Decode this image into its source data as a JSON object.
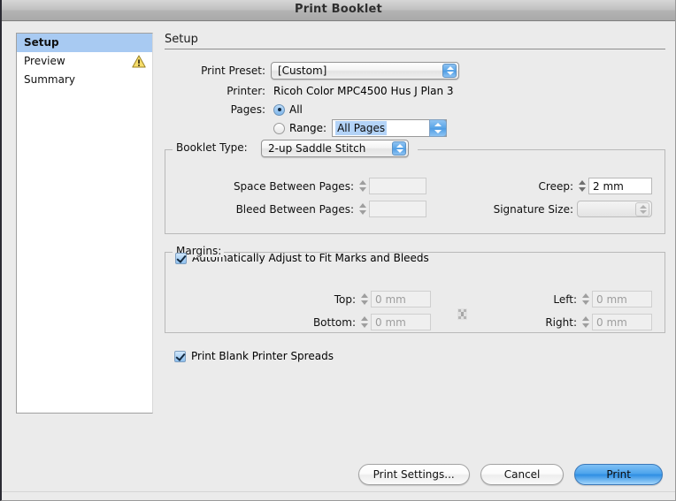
{
  "window": {
    "title": "Print Booklet"
  },
  "sidebar": {
    "items": [
      {
        "label": "Setup",
        "selected": true,
        "warning": false
      },
      {
        "label": "Preview",
        "selected": false,
        "warning": true
      },
      {
        "label": "Summary",
        "selected": false,
        "warning": false
      }
    ]
  },
  "panel": {
    "title": "Setup",
    "print_preset": {
      "label": "Print Preset:",
      "value": "[Custom]"
    },
    "printer": {
      "label": "Printer:",
      "value": "Ricoh Color MPC4500 Hus J Plan 3"
    },
    "pages": {
      "label": "Pages:",
      "all_label": "All",
      "all_selected": true,
      "range_label": "Range:",
      "range_selected": false,
      "range_value": "All Pages"
    }
  },
  "booklet": {
    "group_label": "Booklet Type:",
    "type_value": "2-up Saddle Stitch",
    "space_between_label": "Space Between Pages:",
    "space_between_value": "",
    "bleed_between_label": "Bleed Between Pages:",
    "bleed_between_value": "",
    "creep_label": "Creep:",
    "creep_value": "2 mm",
    "signature_label": "Signature Size:",
    "signature_value": ""
  },
  "margins": {
    "group_label": "Margins:",
    "auto_adjust_label": "Automatically Adjust to Fit Marks and Bleeds",
    "auto_adjust_checked": true,
    "top_label": "Top:",
    "top_value": "0 mm",
    "bottom_label": "Bottom:",
    "bottom_value": "0 mm",
    "left_label": "Left:",
    "left_value": "0 mm",
    "right_label": "Right:",
    "right_value": "0 mm"
  },
  "options": {
    "blank_spreads_label": "Print Blank Printer Spreads",
    "blank_spreads_checked": true
  },
  "buttons": {
    "print_settings": "Print Settings...",
    "cancel": "Cancel",
    "print": "Print"
  },
  "colors": {
    "selection_blue": "#a8caf2",
    "default_button_blue": "#4ea4ec",
    "warning_yellow": "#f2d14c",
    "window_background": "#ebebeb"
  }
}
